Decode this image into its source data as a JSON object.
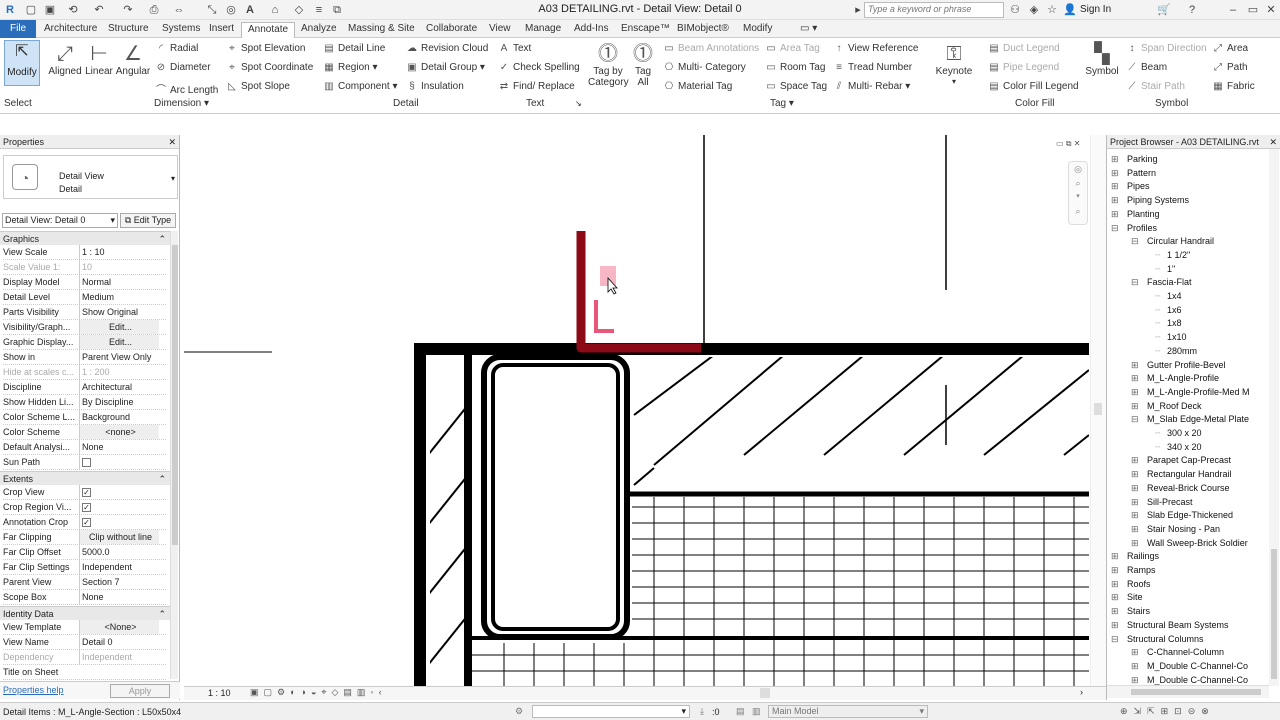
{
  "title": "A03 DETAILING.rvt - Detail View: Detail 0",
  "search": {
    "placeholder": "Type a keyword or phrase"
  },
  "signin": "Sign In",
  "tabs": [
    "File",
    "Architecture",
    "Structure",
    "Systems",
    "Insert",
    "Annotate",
    "Analyze",
    "Massing & Site",
    "Collaborate",
    "View",
    "Manage",
    "Add-Ins",
    "Enscape™",
    "BIMobject®",
    "Modify"
  ],
  "ribbon": {
    "select_label": "Select",
    "modify": "Modify",
    "dimension": {
      "aligned": "Aligned",
      "linear": "Linear",
      "angular": "Angular",
      "radial": "Radial",
      "diameter": "Diameter",
      "arc_length": "Arc Length",
      "spot_elevation": "Spot Elevation",
      "spot_coordinate": "Spot Coordinate",
      "spot_slope": "Spot Slope",
      "label": "Dimension"
    },
    "detail": {
      "detail_line": "Detail Line",
      "region": "Region",
      "component": "Component",
      "revision_cloud": "Revision Cloud",
      "detail_group": "Detail Group",
      "insulation": "Insulation",
      "label": "Detail"
    },
    "text": {
      "text": "Text",
      "check_spelling": "Check Spelling",
      "find_replace": "Find/ Replace",
      "label": "Text"
    },
    "tag": {
      "tag_by_category": "Tag by Category",
      "tag_all": "Tag All",
      "beam_annotations": "Beam Annotations",
      "multi_category": "Multi- Category",
      "material_tag": "Material Tag",
      "area_tag": "Area Tag",
      "room_tag": "Room Tag",
      "space_tag": "Space Tag",
      "view_reference": "View Reference",
      "tread_number": "Tread Number",
      "multi_rebar": "Multi- Rebar",
      "label": "Tag"
    },
    "keynote": "Keynote",
    "colorfill": {
      "duct_legend": "Duct Legend",
      "pipe_legend": "Pipe Legend",
      "color_fill_legend": "Color Fill Legend",
      "label": "Color Fill"
    },
    "symbol": {
      "symbol": "Symbol",
      "span_direction": "Span Direction",
      "beam": "Beam",
      "stair_path": "Stair Path",
      "area": "Area",
      "path": "Path",
      "fabric": "Fabric",
      "label": "Symbol"
    }
  },
  "properties": {
    "header": "Properties",
    "type_name": "Detail View",
    "type_sub": "Detail",
    "selector": "Detail View: Detail 0",
    "edit_type": "Edit Type",
    "sections": [
      "Graphics",
      "Extents",
      "Identity Data"
    ],
    "graphics": [
      {
        "k": "View Scale",
        "v": "1 : 10"
      },
      {
        "k": "Scale Value    1:",
        "v": "10",
        "dim": true
      },
      {
        "k": "Display Model",
        "v": "Normal"
      },
      {
        "k": "Detail Level",
        "v": "Medium"
      },
      {
        "k": "Parts Visibility",
        "v": "Show Original"
      },
      {
        "k": "Visibility/Graph...",
        "v": "Edit...",
        "btn": true
      },
      {
        "k": "Graphic Display...",
        "v": "Edit...",
        "btn": true
      },
      {
        "k": "Show in",
        "v": "Parent View Only"
      },
      {
        "k": "Hide at scales c...",
        "v": "1 : 200",
        "dim": true
      },
      {
        "k": "Discipline",
        "v": "Architectural"
      },
      {
        "k": "Show Hidden Li...",
        "v": "By Discipline"
      },
      {
        "k": "Color Scheme L...",
        "v": "Background"
      },
      {
        "k": "Color Scheme",
        "v": "<none>",
        "btn": true
      },
      {
        "k": "Default Analysi...",
        "v": "None"
      },
      {
        "k": "Sun Path",
        "v": "",
        "chk": false
      }
    ],
    "extents": [
      {
        "k": "Crop View",
        "v": "",
        "chk": true
      },
      {
        "k": "Crop Region Vi...",
        "v": "",
        "chk": true
      },
      {
        "k": "Annotation Crop",
        "v": "",
        "chk": true
      },
      {
        "k": "Far Clipping",
        "v": "Clip without line",
        "btn": true
      },
      {
        "k": "Far Clip Offset",
        "v": "5000.0"
      },
      {
        "k": "Far Clip Settings",
        "v": "Independent"
      },
      {
        "k": "Parent View",
        "v": "Section 7"
      },
      {
        "k": "Scope Box",
        "v": "None"
      }
    ],
    "identity": [
      {
        "k": "View Template",
        "v": "<None>",
        "btn": true
      },
      {
        "k": "View Name",
        "v": "Detail 0"
      },
      {
        "k": "Dependency",
        "v": "Independent",
        "dim": true
      },
      {
        "k": "Title on Sheet",
        "v": ""
      }
    ],
    "help": "Properties help",
    "apply": "Apply"
  },
  "browser": {
    "header": "Project Browser - A03 DETAILING.rvt",
    "items": [
      {
        "t": "Parking",
        "lvl": 1,
        "exp": "+"
      },
      {
        "t": "Pattern",
        "lvl": 1,
        "exp": "+"
      },
      {
        "t": "Pipes",
        "lvl": 1,
        "exp": "+"
      },
      {
        "t": "Piping Systems",
        "lvl": 1,
        "exp": "+"
      },
      {
        "t": "Planting",
        "lvl": 1,
        "exp": "+"
      },
      {
        "t": "Profiles",
        "lvl": 1,
        "exp": "-"
      },
      {
        "t": "Circular Handrail",
        "lvl": 2,
        "exp": "-"
      },
      {
        "t": "1 1/2\"",
        "lvl": 3,
        "exp": ""
      },
      {
        "t": "1\"",
        "lvl": 3,
        "exp": ""
      },
      {
        "t": "Fascia-Flat",
        "lvl": 2,
        "exp": "-"
      },
      {
        "t": "1x4",
        "lvl": 3,
        "exp": ""
      },
      {
        "t": "1x6",
        "lvl": 3,
        "exp": ""
      },
      {
        "t": "1x8",
        "lvl": 3,
        "exp": ""
      },
      {
        "t": "1x10",
        "lvl": 3,
        "exp": ""
      },
      {
        "t": "280mm",
        "lvl": 3,
        "exp": ""
      },
      {
        "t": "Gutter Profile-Bevel",
        "lvl": 2,
        "exp": "+"
      },
      {
        "t": "M_L-Angle-Profile",
        "lvl": 2,
        "exp": "+"
      },
      {
        "t": "M_L-Angle-Profile-Med M",
        "lvl": 2,
        "exp": "+"
      },
      {
        "t": "M_Roof Deck",
        "lvl": 2,
        "exp": "+"
      },
      {
        "t": "M_Slab Edge-Metal Plate",
        "lvl": 2,
        "exp": "-"
      },
      {
        "t": "300 x 20",
        "lvl": 3,
        "exp": ""
      },
      {
        "t": "340 x 20",
        "lvl": 3,
        "exp": ""
      },
      {
        "t": "Parapet Cap-Precast",
        "lvl": 2,
        "exp": "+"
      },
      {
        "t": "Rectangular Handrail",
        "lvl": 2,
        "exp": "+"
      },
      {
        "t": "Reveal-Brick Course",
        "lvl": 2,
        "exp": "+"
      },
      {
        "t": "Sill-Precast",
        "lvl": 2,
        "exp": "+"
      },
      {
        "t": "Slab Edge-Thickened",
        "lvl": 2,
        "exp": "+"
      },
      {
        "t": "Stair Nosing - Pan",
        "lvl": 2,
        "exp": "+"
      },
      {
        "t": "Wall Sweep-Brick Soldier",
        "lvl": 2,
        "exp": "+"
      },
      {
        "t": "Railings",
        "lvl": 1,
        "exp": "+"
      },
      {
        "t": "Ramps",
        "lvl": 1,
        "exp": "+"
      },
      {
        "t": "Roofs",
        "lvl": 1,
        "exp": "+"
      },
      {
        "t": "Site",
        "lvl": 1,
        "exp": "+"
      },
      {
        "t": "Stairs",
        "lvl": 1,
        "exp": "+"
      },
      {
        "t": "Structural Beam Systems",
        "lvl": 1,
        "exp": "+"
      },
      {
        "t": "Structural Columns",
        "lvl": 1,
        "exp": "-"
      },
      {
        "t": "C-Channel-Column",
        "lvl": 2,
        "exp": "+"
      },
      {
        "t": "M_Double C-Channel-Co",
        "lvl": 2,
        "exp": "+"
      },
      {
        "t": "M_Double C-Channel-Co",
        "lvl": 2,
        "exp": "+"
      }
    ]
  },
  "viewbar": {
    "scale": "1 : 10"
  },
  "status": {
    "text": "Detail Items : M_L-Angle-Section : L50x50x4",
    "zero": ":0",
    "model": "Main Model"
  },
  "colors": {
    "accent": "#2a6ebb",
    "selection": "#8b0a16",
    "highlight": "#e8577a"
  }
}
